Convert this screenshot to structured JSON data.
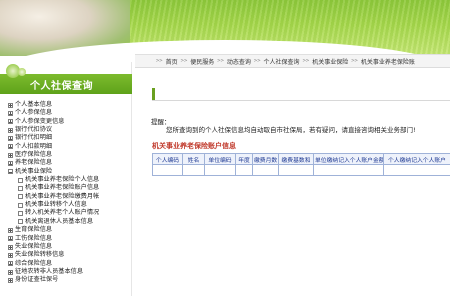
{
  "nav": {
    "items": [
      "首页",
      "便民服务",
      "动态查询",
      "个人社保查询",
      "机关事业保险",
      "机关事业养老保险账"
    ]
  },
  "sidebar": {
    "title": "个人社保查询",
    "items": [
      {
        "label": "个人基本信息",
        "level": 0
      },
      {
        "label": "个人参保信息",
        "level": 0
      },
      {
        "label": "个人参保变更信息",
        "level": 0
      },
      {
        "label": "银行代扣协议",
        "level": 0
      },
      {
        "label": "银行代扣明细",
        "level": 0
      },
      {
        "label": "个人扣款明细",
        "level": 0
      },
      {
        "label": "医疗保险信息",
        "level": 0
      },
      {
        "label": "养老保险信息",
        "level": 0
      },
      {
        "label": "机关事业保险",
        "level": 0
      },
      {
        "label": "机关事业养老保险个人信息",
        "level": 1
      },
      {
        "label": "机关事业养老保险账户信息",
        "level": 1
      },
      {
        "label": "机关事业养老保险缴费月帐",
        "level": 1
      },
      {
        "label": "机关事业转移个人信息",
        "level": 1
      },
      {
        "label": "转入机关养老个人账户情况",
        "level": 1
      },
      {
        "label": "机关离退休人员基本信息",
        "level": 1
      },
      {
        "label": "生育保险信息",
        "level": 0
      },
      {
        "label": "工伤保险信息",
        "level": 0
      },
      {
        "label": "失业保险信息",
        "level": 0
      },
      {
        "label": "失业保险转移信息",
        "level": 0
      },
      {
        "label": "综合保险信息",
        "level": 0
      },
      {
        "label": "征地农转非人员基本信息",
        "level": 0
      },
      {
        "label": "身份证查社保号",
        "level": 0
      }
    ]
  },
  "main": {
    "tip_label": "提醒：",
    "tip_text": "您所查询到的个人社保信息均自动取自市社保局，若有疑问，请直接咨询相关业务部门!",
    "section_title": "机关事业养老保险账户信息",
    "table": {
      "headers": [
        "个人编码",
        "姓名",
        "单位编码",
        "年度",
        "缴费月数",
        "缴费基数和",
        "单位缴纳记入个人账户金额",
        "个人缴纳记入个人账户"
      ]
    }
  },
  "colors": {
    "accent_green": "#6aa020",
    "section_title": "#c0392b",
    "table_header_text": "#1f3a93",
    "table_border": "#9fb2d8"
  }
}
